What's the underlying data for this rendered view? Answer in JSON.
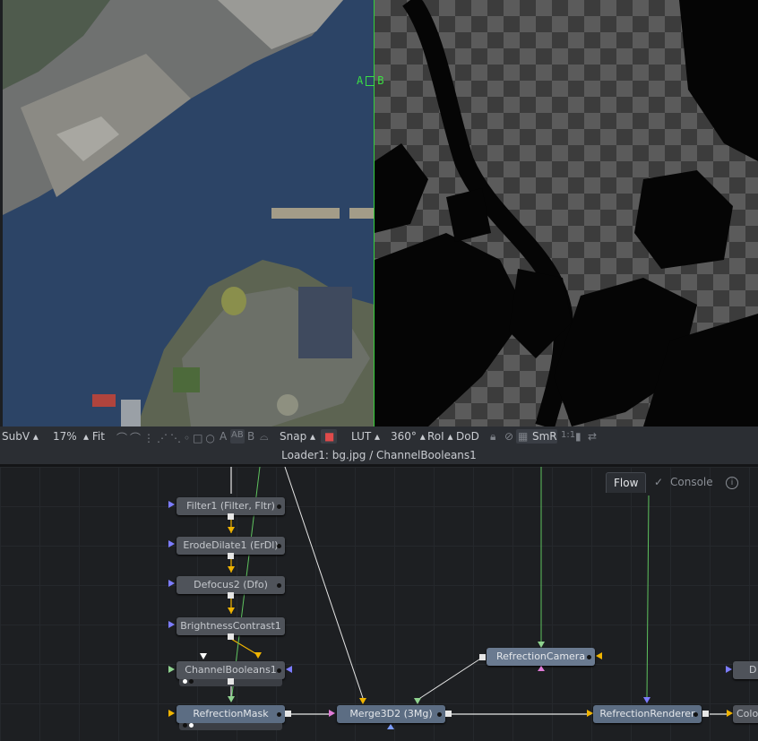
{
  "viewer": {
    "left_label": "A",
    "right_label": "B"
  },
  "toolbar": {
    "subv": "SubV ▴",
    "zoom": "17%",
    "fit": "▴ Fit",
    "a": "A",
    "ab": "AB",
    "b": "B",
    "snap": "Snap ▴",
    "lut": "LUT ▴",
    "deg": "360° ▴",
    "roi": "RoI ▴",
    "dod": "DoD",
    "smr": "SmR",
    "ratio": "1:1"
  },
  "breadcrumb": "Loader1: bg.jpg / ChannelBooleans1",
  "tabs": {
    "flow": "Flow",
    "console": "Console",
    "info": "i"
  },
  "nodes": {
    "filter1": "Filter1  (Filter, Fltr)",
    "erode": "ErodeDilate1  (ErDl)",
    "defocus": "Defocus2  (Dfo)",
    "brightness": "BrightnessContrast1",
    "channel": "ChannelBooleans1",
    "refmask": "RefrectionMask",
    "merge": "Merge3D2  (3Mg)",
    "camera": "RefrectionCamera",
    "renderer": "RefrectionRenderer",
    "color": "Colo",
    "d": "D"
  },
  "colors": {
    "accent_green": "#34d13a",
    "wire_yellow": "#f0b400",
    "wire_green": "#5fc35f",
    "wire_white": "#e6e6e6",
    "node_grey": "#4f535a",
    "node_blue": "#6a7a90"
  }
}
